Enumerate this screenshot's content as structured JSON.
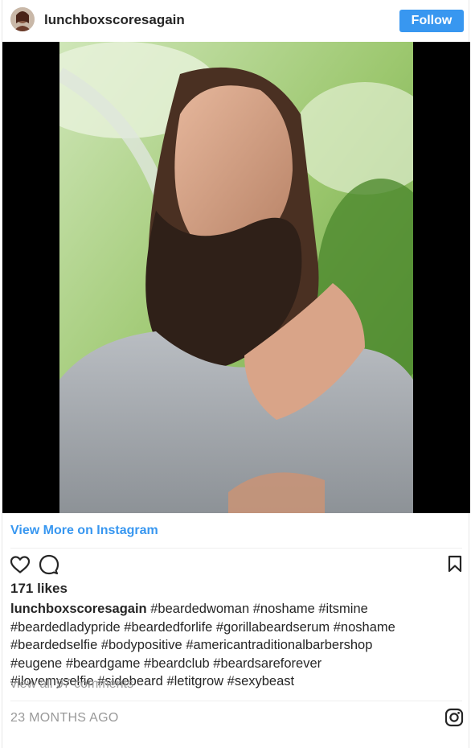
{
  "header": {
    "username": "lunchboxscoresagain",
    "follow_label": "Follow"
  },
  "post": {
    "view_more_label": "View More on Instagram",
    "likes": "171 likes",
    "caption_user": "lunchboxscoresagain",
    "caption_lines": [
      "#beardedwoman #noshame #itsmine",
      "#beardedladypride #beardedforlife #gorillabeardserum #noshame",
      "#beardedselfie #bodypositive #americantraditionalbarbershop",
      "#eugene #beardgame #beardclub #beardsareforever",
      "#ilovemyselfie #sidebeard #letitgrow #sexybeast"
    ],
    "comments_link": "view all 97 comments",
    "timestamp": "23 MONTHS AGO"
  },
  "icons": {
    "like": "heart-icon",
    "comment": "comment-icon",
    "save": "bookmark-icon",
    "brand": "instagram-icon"
  },
  "colors": {
    "accent": "#3897f0",
    "text": "#262626",
    "muted": "#999999"
  }
}
